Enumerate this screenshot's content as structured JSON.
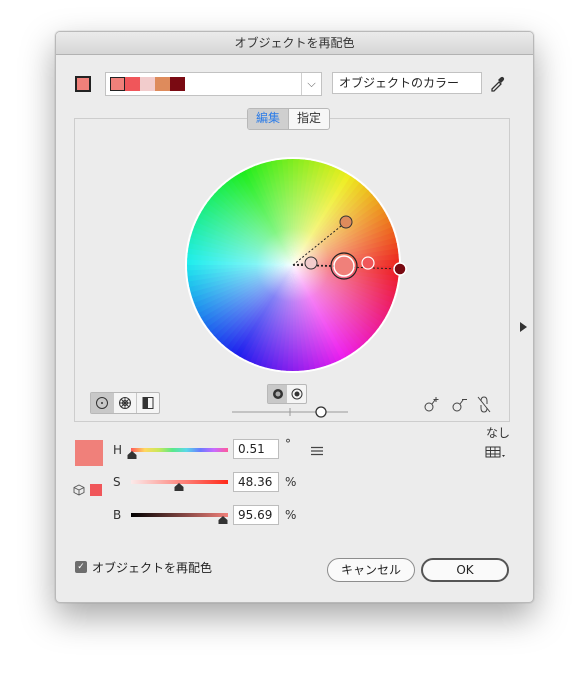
{
  "dialog": {
    "title": "オブジェクトを再配色"
  },
  "colors": {
    "base": "#f0807a",
    "group": [
      "#f0807a",
      "#f0565a",
      "#f2cccc",
      "#de8b5c",
      "#7a0a12"
    ],
    "small_swatch": "#f0565a"
  },
  "top": {
    "name_value": "オブジェクトのカラー",
    "dropdown_arrow": "⌵",
    "eyedropper_icon": "eyedropper-icon"
  },
  "tabs": [
    {
      "label": "編集",
      "active": true
    },
    {
      "label": "指定",
      "active": false
    }
  ],
  "wheel": {
    "modes": [
      "smooth-wheel-icon",
      "segmented-wheel-icon",
      "color-bars-icon"
    ],
    "active_mode": 0,
    "display_options": [
      "show-saturation-hue-icon",
      "show-brightness-hue-icon"
    ],
    "tools": [
      "add-color-tool-icon",
      "remove-color-tool-icon",
      "unlink-harmony-icon"
    ]
  },
  "sliders": {
    "h": {
      "label": "H",
      "value": "0.51",
      "unit": "°"
    },
    "s": {
      "label": "S",
      "value": "48.36",
      "unit": "%"
    },
    "b": {
      "label": "B",
      "value": "95.69",
      "unit": "%"
    }
  },
  "limit_label": "なし",
  "footer": {
    "recolor_checkbox_label": "オブジェクトを再配色",
    "recolor_checked": true,
    "cancel_label": "キャンセル",
    "ok_label": "OK"
  }
}
